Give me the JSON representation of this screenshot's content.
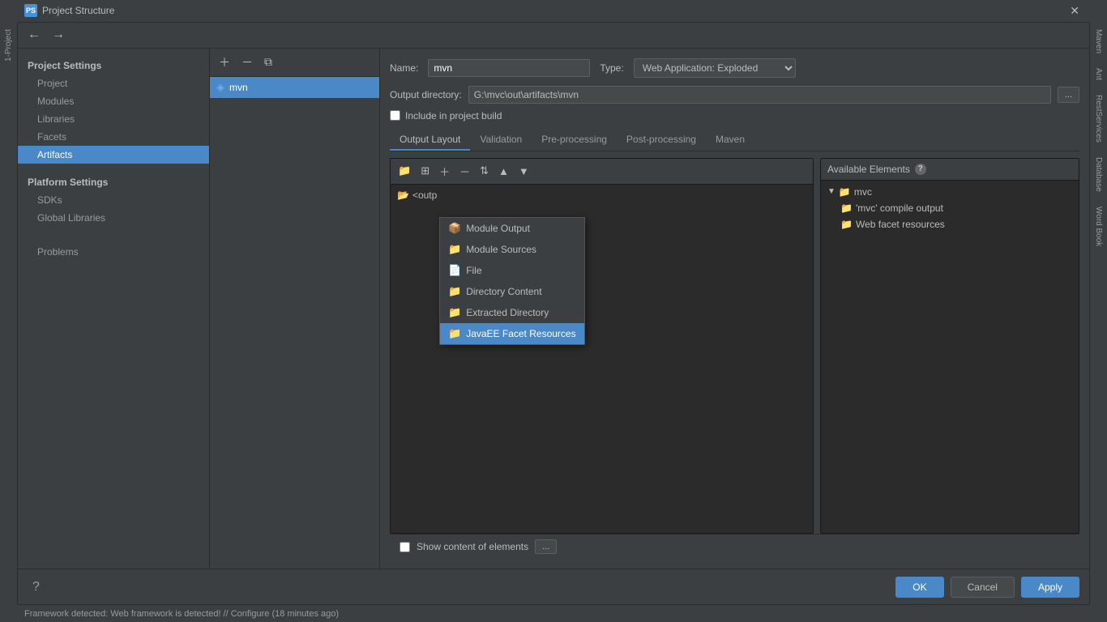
{
  "window": {
    "title": "Project Structure",
    "icon": "PS"
  },
  "toolbar": {
    "back_label": "←",
    "forward_label": "→"
  },
  "sidebar": {
    "project_settings_title": "Project Settings",
    "platform_settings_title": "Platform Settings",
    "items": [
      {
        "id": "project",
        "label": "Project"
      },
      {
        "id": "modules",
        "label": "Modules"
      },
      {
        "id": "libraries",
        "label": "Libraries"
      },
      {
        "id": "facets",
        "label": "Facets"
      },
      {
        "id": "artifacts",
        "label": "Artifacts"
      },
      {
        "id": "sdks",
        "label": "SDKs"
      },
      {
        "id": "global-libraries",
        "label": "Global Libraries"
      },
      {
        "id": "problems",
        "label": "Problems"
      }
    ]
  },
  "artifact": {
    "name": "mvn",
    "icon": "◈",
    "list_item": "mvn"
  },
  "form": {
    "name_label": "Name:",
    "name_value": "mvn",
    "type_label": "Type:",
    "type_value": "Web Application: Exploded",
    "output_dir_label": "Output directory:",
    "output_dir_value": "G:\\mvc\\out\\artifacts\\mvn",
    "include_label": "Include in project build",
    "browse_label": "..."
  },
  "tabs": [
    {
      "id": "output-layout",
      "label": "Output Layout"
    },
    {
      "id": "validation",
      "label": "Validation"
    },
    {
      "id": "pre-processing",
      "label": "Pre-processing"
    },
    {
      "id": "post-processing",
      "label": "Post-processing"
    },
    {
      "id": "maven",
      "label": "Maven"
    }
  ],
  "tree": {
    "root_item": "<outp"
  },
  "dropdown": {
    "items": [
      {
        "id": "module-output",
        "label": "Module Output",
        "icon": "📦"
      },
      {
        "id": "module-sources",
        "label": "Module Sources",
        "icon": "📁"
      },
      {
        "id": "file",
        "label": "File",
        "icon": "📄"
      },
      {
        "id": "directory-content",
        "label": "Directory Content",
        "icon": "📁"
      },
      {
        "id": "extracted-directory",
        "label": "Extracted Directory",
        "icon": "📁"
      },
      {
        "id": "javaee-facet-resources",
        "label": "JavaEE Facet Resources",
        "icon": "📁"
      }
    ]
  },
  "available_elements": {
    "header": "Available Elements",
    "tree": {
      "root": "mvc",
      "children": [
        {
          "label": "'mvc' compile output"
        },
        {
          "label": "Web facet resources"
        }
      ]
    }
  },
  "bottom": {
    "show_content_label": "Show content of elements",
    "ellipsis_label": "..."
  },
  "footer": {
    "ok_label": "OK",
    "cancel_label": "Cancel",
    "apply_label": "Apply"
  },
  "status_bar": {
    "text": "Framework detected: Web framework is detected! // Configure (18 minutes ago)"
  }
}
